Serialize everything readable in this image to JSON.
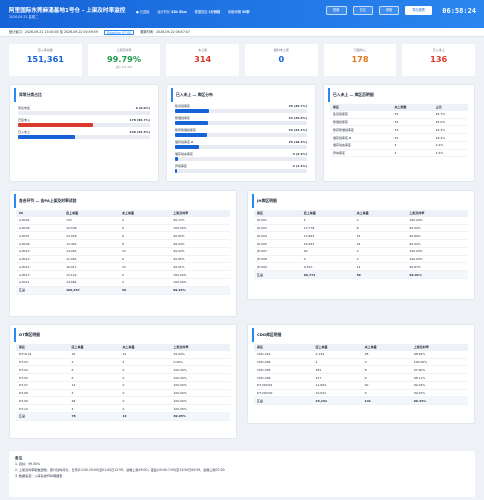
{
  "header": {
    "title": "阿里国际东莞麻涌基地1号仓 - 上架及时率监控",
    "date": "2026-09-21 星期二",
    "metas": [
      {
        "label": "● 已连接",
        "value": ""
      },
      {
        "label": "运行时长",
        "value": "43h 52m"
      },
      {
        "label": "数据延迟",
        "value": "1分钟前"
      },
      {
        "label": "刷新间隔",
        "value": "30秒"
      }
    ],
    "buttons": [
      "配置",
      "日志",
      "帮助",
      "导出报表"
    ],
    "clock": "06:58:24"
  },
  "subbar": {
    "window": "统计窗口：2026-09-21 13:00:00 至 2026-09-22 00:59:59",
    "deadline": "Deadline 07:00",
    "updated": "更新时间：2026-09-22 06:57:07"
  },
  "kpis": [
    {
      "label": "应入库总数",
      "value": "151,361",
      "sub": "",
      "color": "#1663d8"
    },
    {
      "label": "上架及时率",
      "value": "99.79%",
      "sub": "达标 151,361",
      "color": "#1e9a4b"
    },
    {
      "label": "未上架",
      "value": "314",
      "sub": "",
      "color": "#d93a2b"
    },
    {
      "label": "超时未上架",
      "value": "0",
      "sub": "",
      "color": "#1663d8"
    },
    {
      "label": "已超时入",
      "value": "178",
      "sub": "",
      "color": "#e07a1f"
    },
    {
      "label": "已入未上",
      "value": "136",
      "sub": "",
      "color": "#d93a2b"
    }
  ],
  "unshelved_classes": {
    "title": "异常分类占比",
    "items": [
      {
        "label": "到达未签",
        "value": "0 (0.0%)",
        "pct": 0,
        "color": "#1663d8"
      },
      {
        "label": "已签未入",
        "value": "178 (56.7%)",
        "pct": 56.7,
        "color": "#d93a2b"
      },
      {
        "label": "已入未上",
        "value": "136 (43.3%)",
        "pct": 43.3,
        "color": "#1663d8"
      }
    ]
  },
  "zone_distribution": {
    "title": "已入未上 — 库区分布",
    "items": [
      {
        "label": "集货批库区",
        "value": "35 (25.7%)",
        "pct": 25.7
      },
      {
        "label": "整储批库区",
        "value": "34 (25.0%)",
        "pct": 25.0
      },
      {
        "label": "整存整储批库区",
        "value": "33 (24.3%)",
        "pct": 24.3
      },
      {
        "label": "储存批库区-B",
        "value": "25 (18.4%)",
        "pct": 18.4
      },
      {
        "label": "储存动态库区",
        "value": "3 (2.2%)",
        "pct": 2.2
      },
      {
        "label": "异常库区",
        "value": "2 (1.5%)",
        "pct": 1.5
      }
    ]
  },
  "zone_table": {
    "title": "已入未上 — 库区后明细",
    "headers": [
      "库区",
      "未上架数",
      "占比"
    ],
    "rows": [
      [
        "集货批库区",
        "35",
        "25.7%"
      ],
      [
        "整储批库区",
        "34",
        "25.0%"
      ],
      [
        "整存整储批库区",
        "33",
        "24.3%"
      ],
      [
        "储存批库区-B",
        "25",
        "18.4%"
      ],
      [
        "储存动态库区",
        "3",
        "2.2%"
      ],
      [
        "异常库区",
        "2",
        "1.5%"
      ]
    ]
  },
  "pa_table": {
    "title": "各合环节 — 含PA上架及时率试验",
    "headers": [
      "PA",
      "应上单量",
      "未上单量",
      "上架及时率"
    ],
    "rows": [
      [
        "A-PA05",
        "722",
        "0",
        "99.72%"
      ],
      [
        "A-PA06",
        "10,538",
        "6",
        "100.00%"
      ],
      [
        "A-PA07",
        "13,028",
        "6",
        "99.95%"
      ],
      [
        "A-PA09",
        "13,402",
        "8",
        "99.94%"
      ],
      [
        "A-PA10",
        "14,062",
        "10",
        "99.93%"
      ],
      [
        "A-PA10",
        "11,062",
        "6",
        "99.95%"
      ],
      [
        "A-PA12",
        "16,017",
        "15",
        "99.91%"
      ],
      [
        "A-PA13",
        "13,122",
        "0",
        "100.00%"
      ],
      [
        "A-PA11",
        "14,664",
        "3",
        "100.00%"
      ]
    ],
    "total": [
      "汇总",
      "106,637",
      "56",
      "99.95%"
    ]
  },
  "jh_table": {
    "title": "JH库区明细",
    "headers": [
      "库区",
      "应上单量",
      "未上单量",
      "上架及时率"
    ],
    "rows": [
      [
        "JH-001",
        "5",
        "0",
        "100.00%"
      ],
      [
        "JH-003",
        "13,778",
        "8",
        "99.94%"
      ],
      [
        "JH-004",
        "13,893",
        "15",
        "99.89%"
      ],
      [
        "JH-005",
        "29,487",
        "24",
        "99.92%"
      ],
      [
        "JH-007",
        "90",
        "0",
        "100.00%"
      ],
      [
        "JH-008",
        "9",
        "0",
        "100.00%"
      ],
      [
        "JH-009",
        "9,510",
        "12",
        "99.87%"
      ]
    ],
    "total": [
      "汇总",
      "66,772",
      "59",
      "99.91%"
    ]
  },
  "dt_table": {
    "title": "DT库区明细",
    "headers": [
      "库区",
      "应上单量",
      "未上单量",
      "上架及时率"
    ],
    "rows": [
      [
        "DTYK-01",
        "16",
        "12",
        "25.00%"
      ],
      [
        "DT-03",
        "2",
        "2",
        "0.00%"
      ],
      [
        "DT-04",
        "6",
        "0",
        "100.00%"
      ],
      [
        "DT-05",
        "6",
        "0",
        "100.00%"
      ],
      [
        "DT-07",
        "12",
        "0",
        "100.00%"
      ],
      [
        "DT-08",
        "4",
        "0",
        "100.00%"
      ],
      [
        "DT-09",
        "28",
        "0",
        "100.00%"
      ],
      [
        "DT-10",
        "4",
        "0",
        "100.00%"
      ]
    ],
    "total": [
      "汇总",
      "78",
      "14",
      "82.05%"
    ]
  },
  "cdd_table": {
    "title": "CDD库区明细",
    "headers": [
      "库区",
      "应上单量",
      "未上单量",
      "上架及时率"
    ],
    "rows": [
      [
        "CDD-001",
        "2,144",
        "28",
        "98.69%"
      ],
      [
        "CDD-004",
        "4",
        "0",
        "100.00%"
      ],
      [
        "CDD-005",
        "381",
        "8",
        "97.90%"
      ],
      [
        "CDD-006",
        "317",
        "6",
        "98.11%"
      ],
      [
        "DT-CDD01",
        "11,664",
        "90",
        "99.23%"
      ],
      [
        "DT-CDD02",
        "10,641",
        "9",
        "99.92%"
      ]
    ],
    "total": [
      "汇总",
      "25,151",
      "141",
      "99.44%"
    ]
  },
  "notes": {
    "title": "备注",
    "lines": [
      "1. 目标：99.50%",
      "2. 上架及时率取数逻辑：按计划时间分，日周(13:00-19:00)至01:00日12:59，最晚上架19:00；夜班(19:00-7:00)至13:00日00:59，最晚上架07:00",
      "3. 数据来源：入库系统PDA明细表"
    ]
  }
}
